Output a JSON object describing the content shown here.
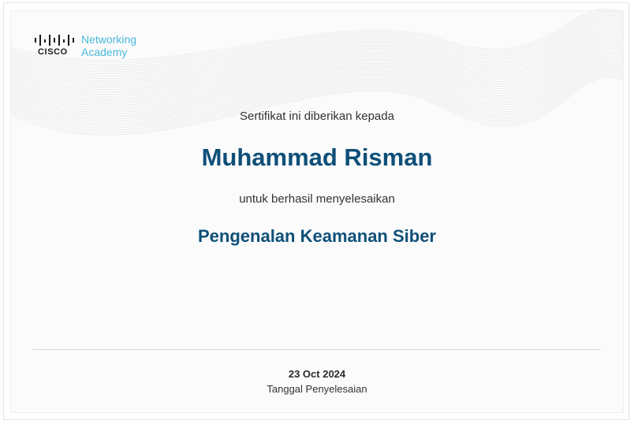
{
  "logo": {
    "wordmark": "CISCO",
    "line1": "Networking",
    "line2": "Academy",
    "text_color": "#49b8d8"
  },
  "certificate": {
    "intro": "Sertifikat ini diberikan kepada",
    "recipient": "Muhammad Risman",
    "completion_text": "untuk berhasil menyelesaikan",
    "course": "Pengenalan Keamanan Siber",
    "date": "23 Oct 2024",
    "date_label": "Tanggal Penyelesaian"
  },
  "colors": {
    "accent": "#0e4f78",
    "text": "#333333",
    "background": "#fbfbfc"
  }
}
